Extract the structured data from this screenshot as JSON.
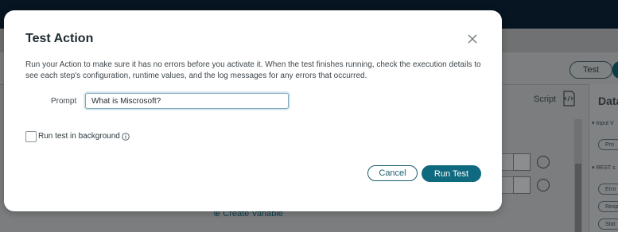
{
  "background": {
    "test_label": "Test",
    "script_label": "Script",
    "data_panel_title": "Data",
    "side_items": [
      "▾ Input V",
      "▾ REST s"
    ],
    "chips": [
      "Pro",
      "Erro",
      "Resp",
      "Stat"
    ],
    "create_variable_label": "⊕ Create Variable"
  },
  "dialog": {
    "title": "Test Action",
    "description": "Run your Action to make sure it has no errors before you activate it. When the test finishes running, check the execution details to see each step's configuration, runtime values, and the log messages for any errors that occurred.",
    "prompt_label": "Prompt",
    "prompt_value": "What is Miscrosoft?",
    "background_checkbox_label": "Run test in background",
    "background_checkbox_checked": false,
    "cancel_label": "Cancel",
    "run_label": "Run Test"
  },
  "colors": {
    "primary": "#0f6a80",
    "topbar": "#061521"
  }
}
